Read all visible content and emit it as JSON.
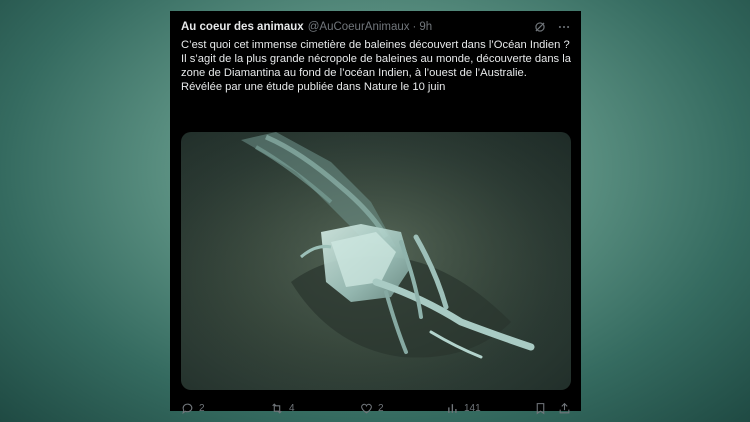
{
  "tweet": {
    "display_name": "Au coeur des animaux",
    "handle": "@AuCoeurAnimaux",
    "separator": "·",
    "time": "9h",
    "icons": {
      "grok": "grok-icon",
      "more": "more-icon"
    },
    "text_lines": [
      "C’est quoi cet immense cimetière de baleines découvert dans l’Océan Indien ?",
      "Il s’agit de la plus grande nécropole de baleines au monde, découverte dans la zone de Diamantina au fond de l’océan Indien, à l’ouest de l’Australie.",
      "Révélée par une étude publiée dans Nature le 10 juin"
    ],
    "media": {
      "image": "deep-sea-whale-skeleton-photo"
    },
    "actions": {
      "replies": "2",
      "reposts": "4",
      "likes": "2",
      "views": "141"
    }
  },
  "colors": {
    "background": "#000000",
    "text": "#e7e9ea",
    "muted": "#71767b"
  }
}
